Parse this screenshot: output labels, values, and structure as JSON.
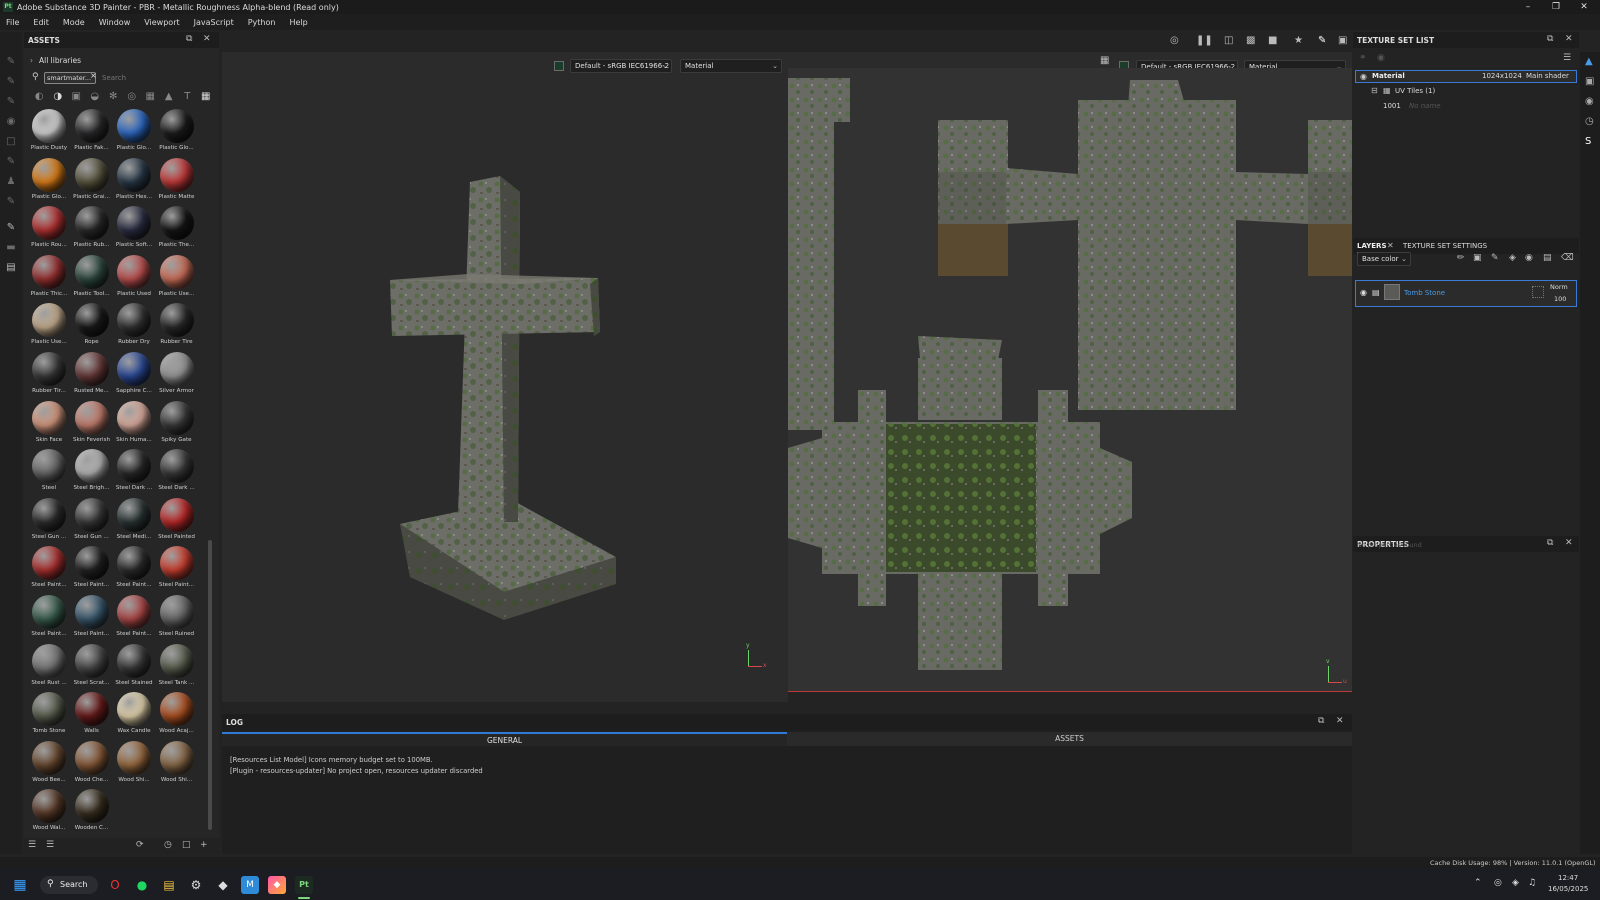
{
  "window": {
    "title": "Adobe Substance 3D Painter - PBR - Metallic Roughness Alpha-blend (Read only)",
    "app_icon": "Pt"
  },
  "menu": [
    "File",
    "Edit",
    "Mode",
    "Window",
    "Viewport",
    "JavaScript",
    "Python",
    "Help"
  ],
  "assets_panel": {
    "title": "ASSETS",
    "breadcrumb": "All libraries",
    "search_chip": "smartmater...",
    "search_placeholder": "Search",
    "materials": [
      {
        "label": "Plastic Dusty",
        "color": "#d8d8d8"
      },
      {
        "label": "Plastic Fak...",
        "color": "#2a2a2c"
      },
      {
        "label": "Plastic Glo...",
        "color": "#2d6bc8"
      },
      {
        "label": "Plastic Glo...",
        "color": "#1c1c1c"
      },
      {
        "label": "Plastic Glo...",
        "color": "#e08016"
      },
      {
        "label": "Plastic Grai...",
        "color": "#5a5640"
      },
      {
        "label": "Plastic Hex...",
        "color": "#2a3a4a"
      },
      {
        "label": "Plastic Matte",
        "color": "#c83a3a"
      },
      {
        "label": "Plastic Rou...",
        "color": "#b83232"
      },
      {
        "label": "Plastic Rub...",
        "color": "#2a2a2a"
      },
      {
        "label": "Plastic Soft...",
        "color": "#2c2e44"
      },
      {
        "label": "Plastic The...",
        "color": "#151515"
      },
      {
        "label": "Plastic Thic...",
        "color": "#9a3030"
      },
      {
        "label": "Plastic Tool...",
        "color": "#2e4a40"
      },
      {
        "label": "Plastic Used",
        "color": "#c05050"
      },
      {
        "label": "Plastic Use...",
        "color": "#d0705a"
      },
      {
        "label": "Plastic Use...",
        "color": "#c8b090"
      },
      {
        "label": "Rope",
        "color": "#1a1a1a"
      },
      {
        "label": "Rubber Dry",
        "color": "#333333"
      },
      {
        "label": "Rubber Tire",
        "color": "#2a2a2a"
      },
      {
        "label": "Rubber Tir...",
        "color": "#3a3a3a"
      },
      {
        "label": "Rusted Me...",
        "color": "#6a3a3a"
      },
      {
        "label": "Sapphire C...",
        "color": "#2a4a9a"
      },
      {
        "label": "Silver Armor",
        "color": "#9a9a9a"
      },
      {
        "label": "Skin Face",
        "color": "#d89a80"
      },
      {
        "label": "Skin Feverish",
        "color": "#c88070"
      },
      {
        "label": "Skin Huma...",
        "color": "#e0b0a0"
      },
      {
        "label": "Spiky Gate",
        "color": "#3a3a3a"
      },
      {
        "label": "Steel",
        "color": "#6a6a6a"
      },
      {
        "label": "Steel Brigh...",
        "color": "#b8b8b8"
      },
      {
        "label": "Steel Dark ...",
        "color": "#2a2a2a"
      },
      {
        "label": "Steel Dark ...",
        "color": "#3a3a3a"
      },
      {
        "label": "Steel Gun ...",
        "color": "#2e2e2e"
      },
      {
        "label": "Steel Gun ...",
        "color": "#3a3a3a"
      },
      {
        "label": "Steel Medi...",
        "color": "#2a3434"
      },
      {
        "label": "Steel Painted",
        "color": "#c02828"
      },
      {
        "label": "Steel Paint...",
        "color": "#b03030"
      },
      {
        "label": "Steel Paint...",
        "color": "#222222"
      },
      {
        "label": "Steel Paint...",
        "color": "#2c2c2c"
      },
      {
        "label": "Steel Paint...",
        "color": "#d04030"
      },
      {
        "label": "Steel Paint...",
        "color": "#3a6050"
      },
      {
        "label": "Steel Paint...",
        "color": "#3a5a70"
      },
      {
        "label": "Steel Paint...",
        "color": "#b04848"
      },
      {
        "label": "Steel Ruined",
        "color": "#6a6a6a"
      },
      {
        "label": "Steel Rust ...",
        "color": "#7a7a7a"
      },
      {
        "label": "Steel Scrat...",
        "color": "#4a4a4a"
      },
      {
        "label": "Steel Stained",
        "color": "#3a3a3a"
      },
      {
        "label": "Steel Tank ...",
        "color": "#5a6050"
      },
      {
        "label": "Tomb Stone",
        "color": "#5a6050"
      },
      {
        "label": "Walls",
        "color": "#6a1a1a"
      },
      {
        "label": "Wax Candle",
        "color": "#e8d8b0"
      },
      {
        "label": "Wood Acaj...",
        "color": "#b05020"
      },
      {
        "label": "Wood Bee...",
        "color": "#6a4a30"
      },
      {
        "label": "Wood Che...",
        "color": "#8a5a38"
      },
      {
        "label": "Wood Shi...",
        "color": "#9a6a40"
      },
      {
        "label": "Wood Shi...",
        "color": "#8a6a48"
      },
      {
        "label": "Wood Wal...",
        "color": "#5a3a28"
      },
      {
        "label": "Wooden C...",
        "color": "#3a3020"
      }
    ]
  },
  "viewport_3d": {
    "colorspace": "Default - sRGB IEC61966-2",
    "display_channel": "Material",
    "axis_labels": [
      "y",
      "x"
    ]
  },
  "viewport_2d": {
    "colorspace": "Default - sRGB IEC61966-2",
    "display_channel": "Material",
    "axis_labels": [
      "v",
      "u"
    ]
  },
  "log_panel": {
    "title": "LOG",
    "tabs": [
      "GENERAL",
      "ASSETS"
    ],
    "lines": [
      "[Resources List Model] Icons memory budget set to 100MB.",
      "[Plugin - resources-updater] No project open, resources updater discarded"
    ]
  },
  "texture_set_list": {
    "title": "TEXTURE SET LIST",
    "material": {
      "name": "Material",
      "resolution": "1024x1024",
      "shader": "Main shader"
    },
    "uv_tiles": "UV Tiles (1)",
    "tile": {
      "id": "1001",
      "note": "No name"
    }
  },
  "layers_panel": {
    "tab_layers": "LAYERS",
    "tab_settings": "TEXTURE SET SETTINGS",
    "channel": "Base color",
    "layer": {
      "name": "Tomb Stone",
      "blend": "Norm",
      "opacity": "100"
    }
  },
  "properties_panel": {
    "title": "PROPERTIES",
    "empty_text": "No properties found"
  },
  "status_bar": {
    "text": "Cache Disk Usage:   98% | Version: 11.0.1 (OpenGL)"
  },
  "taskbar": {
    "search_label": "Search",
    "pinned_app": "Pt",
    "time": "12:47",
    "date": "16/05/2025"
  },
  "colors": {
    "accent": "#2f7bd8",
    "layer_name": "#4a9ae8",
    "moss": "#4a6a3a"
  }
}
